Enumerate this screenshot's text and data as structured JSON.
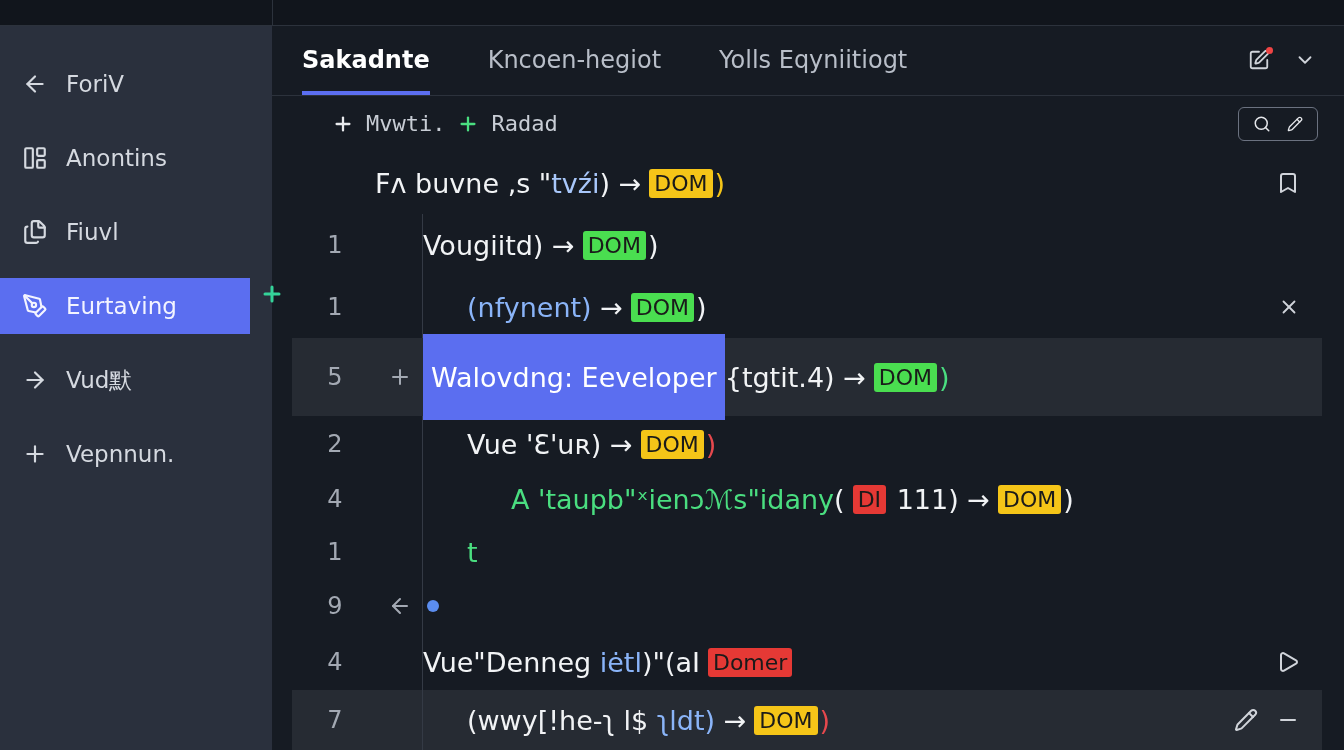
{
  "sidebar": {
    "items": [
      {
        "label": "ForiV",
        "selected": false
      },
      {
        "label": "Anontins",
        "selected": false
      },
      {
        "label": "Fiuvl",
        "selected": false
      },
      {
        "label": "Eurtaving",
        "selected": true
      },
      {
        "label": "Vud默",
        "selected": false
      },
      {
        "label": "Vepnnun.",
        "selected": false
      }
    ]
  },
  "tabs": [
    {
      "label": "Sakadnte",
      "selected": true
    },
    {
      "label": "Kncoen-hegiot",
      "selected": false
    },
    {
      "label": "Yolls Eqyniitiogt",
      "selected": false
    }
  ],
  "toolbar": {
    "actions": [
      {
        "label": "Mvwti.",
        "color": "#e8eaed"
      },
      {
        "label": "Radad",
        "color": "#4ade80"
      }
    ]
  },
  "code_lines": [
    {
      "highlighted": false,
      "segments": [
        {
          "kind": "text",
          "text": "Fᴧ buvne ,s \"",
          "color": "#f1f3f5"
        },
        {
          "kind": "text",
          "text": "tvźi",
          "color": "#a8c7fa"
        },
        {
          "kind": "text",
          "text": ") →",
          "color": "#f1f3f5"
        },
        {
          "kind": "tag",
          "text": "DOM",
          "color": "#f5c518"
        },
        {
          "kind": "text",
          "text": ")",
          "color": "#f5c518"
        }
      ]
    },
    {
      "number": "1",
      "highlighted": false,
      "segments": [
        {
          "kind": "text",
          "text": "Vougiitd) →",
          "color": "#f1f3f5"
        },
        {
          "kind": "tag",
          "text": "DOM",
          "color": "#4ade50"
        },
        {
          "kind": "text",
          "text": ")",
          "color": "#f1f3f5"
        }
      ]
    },
    {
      "number": "1",
      "highlighted": false,
      "segments": [
        {
          "kind": "text",
          "text": "(nfynent)",
          "color": "#8ab4f8"
        },
        {
          "kind": "text",
          "text": " →",
          "color": "#f1f3f5"
        },
        {
          "kind": "tag",
          "text": "DOM",
          "color": "#4ade50"
        },
        {
          "kind": "text",
          "text": ")",
          "color": "#f1f3f5"
        }
      ]
    },
    {
      "number": "5",
      "highlighted": true,
      "segments": [
        {
          "kind": "selection",
          "text": "Walovdng: Eeveloper",
          "color": "#5b6ef0"
        },
        {
          "kind": "text",
          "text": "{tgtit.4) →",
          "color": "#f1f3f5"
        },
        {
          "kind": "tag",
          "text": "DOM",
          "color": "#4ade50"
        },
        {
          "kind": "text",
          "text": ")",
          "color": "#4ade80"
        }
      ]
    },
    {
      "number": "2",
      "highlighted": false,
      "segments": [
        {
          "kind": "text",
          "text": "Vue 'Ɛ'uʀ) →",
          "color": "#f1f3f5"
        },
        {
          "kind": "tag",
          "text": "DOM",
          "color": "#f5c518"
        },
        {
          "kind": "text",
          "text": ")",
          "color": "#e5484d"
        }
      ]
    },
    {
      "number": "4",
      "highlighted": false,
      "segments": [
        {
          "kind": "text",
          "text": "A 'taupb\"ˣienɔℳs\"idany",
          "color": "#4ade80"
        },
        {
          "kind": "text",
          "text": "(",
          "color": "#f1f3f5"
        },
        {
          "kind": "tag",
          "text": "DI",
          "color": "#e53935"
        },
        {
          "kind": "text",
          "text": " 111) →",
          "color": "#f1f3f5"
        },
        {
          "kind": "tag",
          "text": "DOM",
          "color": "#f5c518"
        },
        {
          "kind": "text",
          "text": ")",
          "color": "#f1f3f5"
        }
      ]
    },
    {
      "number": "1",
      "highlighted": false,
      "segments": [
        {
          "kind": "text",
          "text": "t",
          "color": "#4ade80"
        }
      ]
    },
    {
      "number": "9",
      "highlighted": false,
      "segments": [
        {
          "kind": "dot",
          "color": "#5b8def"
        }
      ]
    },
    {
      "number": "4",
      "highlighted": false,
      "segments": [
        {
          "kind": "text",
          "text": "Vue\"Denneg",
          "color": "#f1f3f5"
        },
        {
          "kind": "text",
          "text": " iėtl",
          "color": "#8ab4f8"
        },
        {
          "kind": "text",
          "text": ")\"(aI",
          "color": "#f1f3f5"
        },
        {
          "kind": "tag",
          "text": "Domer",
          "color": "#e53935"
        }
      ]
    },
    {
      "number": "7",
      "highlighted": true,
      "segments": [
        {
          "kind": "text",
          "text": "(wwy[!he-ʅ l$",
          "color": "#f1f3f5"
        },
        {
          "kind": "text",
          "text": " ʅldt)",
          "color": "#8ab4f8"
        },
        {
          "kind": "text",
          "text": " →",
          "color": "#f1f3f5"
        },
        {
          "kind": "tag",
          "text": "DOM",
          "color": "#f5c518"
        },
        {
          "kind": "text",
          "text": ")",
          "color": "#e5484d"
        }
      ]
    }
  ]
}
